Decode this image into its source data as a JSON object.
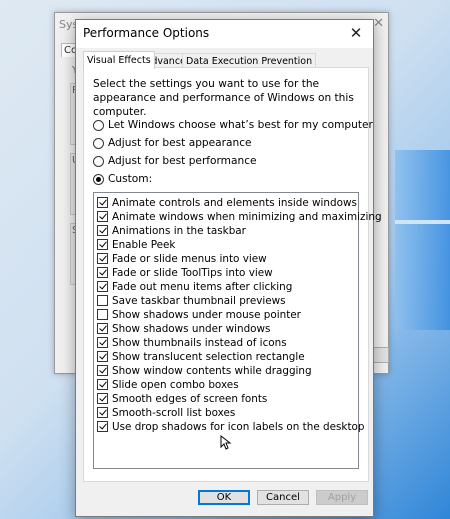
{
  "back_window": {
    "title": "Syste",
    "tab": "Com",
    "letters": [
      "Y",
      "P",
      "U",
      "S"
    ]
  },
  "dialog": {
    "title": "Performance Options",
    "close_icon": "close-icon"
  },
  "tabs": [
    {
      "label": "Visual Effects",
      "active": true
    },
    {
      "label": "Advanced",
      "active": false
    },
    {
      "label": "Data Execution Prevention",
      "active": false
    }
  ],
  "description": "Select the settings you want to use for the appearance and performance of Windows on this computer.",
  "radios": [
    {
      "label": "Let Windows choose what’s best for my computer",
      "checked": false
    },
    {
      "label": "Adjust for best appearance",
      "checked": false
    },
    {
      "label": "Adjust for best performance",
      "checked": false
    },
    {
      "label": "Custom:",
      "checked": true
    }
  ],
  "options": [
    {
      "label": "Animate controls and elements inside windows",
      "checked": true
    },
    {
      "label": "Animate windows when minimizing and maximizing",
      "checked": true
    },
    {
      "label": "Animations in the taskbar",
      "checked": true
    },
    {
      "label": "Enable Peek",
      "checked": true
    },
    {
      "label": "Fade or slide menus into view",
      "checked": true
    },
    {
      "label": "Fade or slide ToolTips into view",
      "checked": true
    },
    {
      "label": "Fade out menu items after clicking",
      "checked": true
    },
    {
      "label": "Save taskbar thumbnail previews",
      "checked": false
    },
    {
      "label": "Show shadows under mouse pointer",
      "checked": false
    },
    {
      "label": "Show shadows under windows",
      "checked": true
    },
    {
      "label": "Show thumbnails instead of icons",
      "checked": true
    },
    {
      "label": "Show translucent selection rectangle",
      "checked": true
    },
    {
      "label": "Show window contents while dragging",
      "checked": true
    },
    {
      "label": "Slide open combo boxes",
      "checked": true
    },
    {
      "label": "Smooth edges of screen fonts",
      "checked": true
    },
    {
      "label": "Smooth-scroll list boxes",
      "checked": true
    },
    {
      "label": "Use drop shadows for icon labels on the desktop",
      "checked": true
    }
  ],
  "buttons": {
    "ok": "OK",
    "cancel": "Cancel",
    "apply": "Apply"
  },
  "colors": {
    "accent": "#0078d7",
    "dialog_bg": "#f0f0f0"
  }
}
